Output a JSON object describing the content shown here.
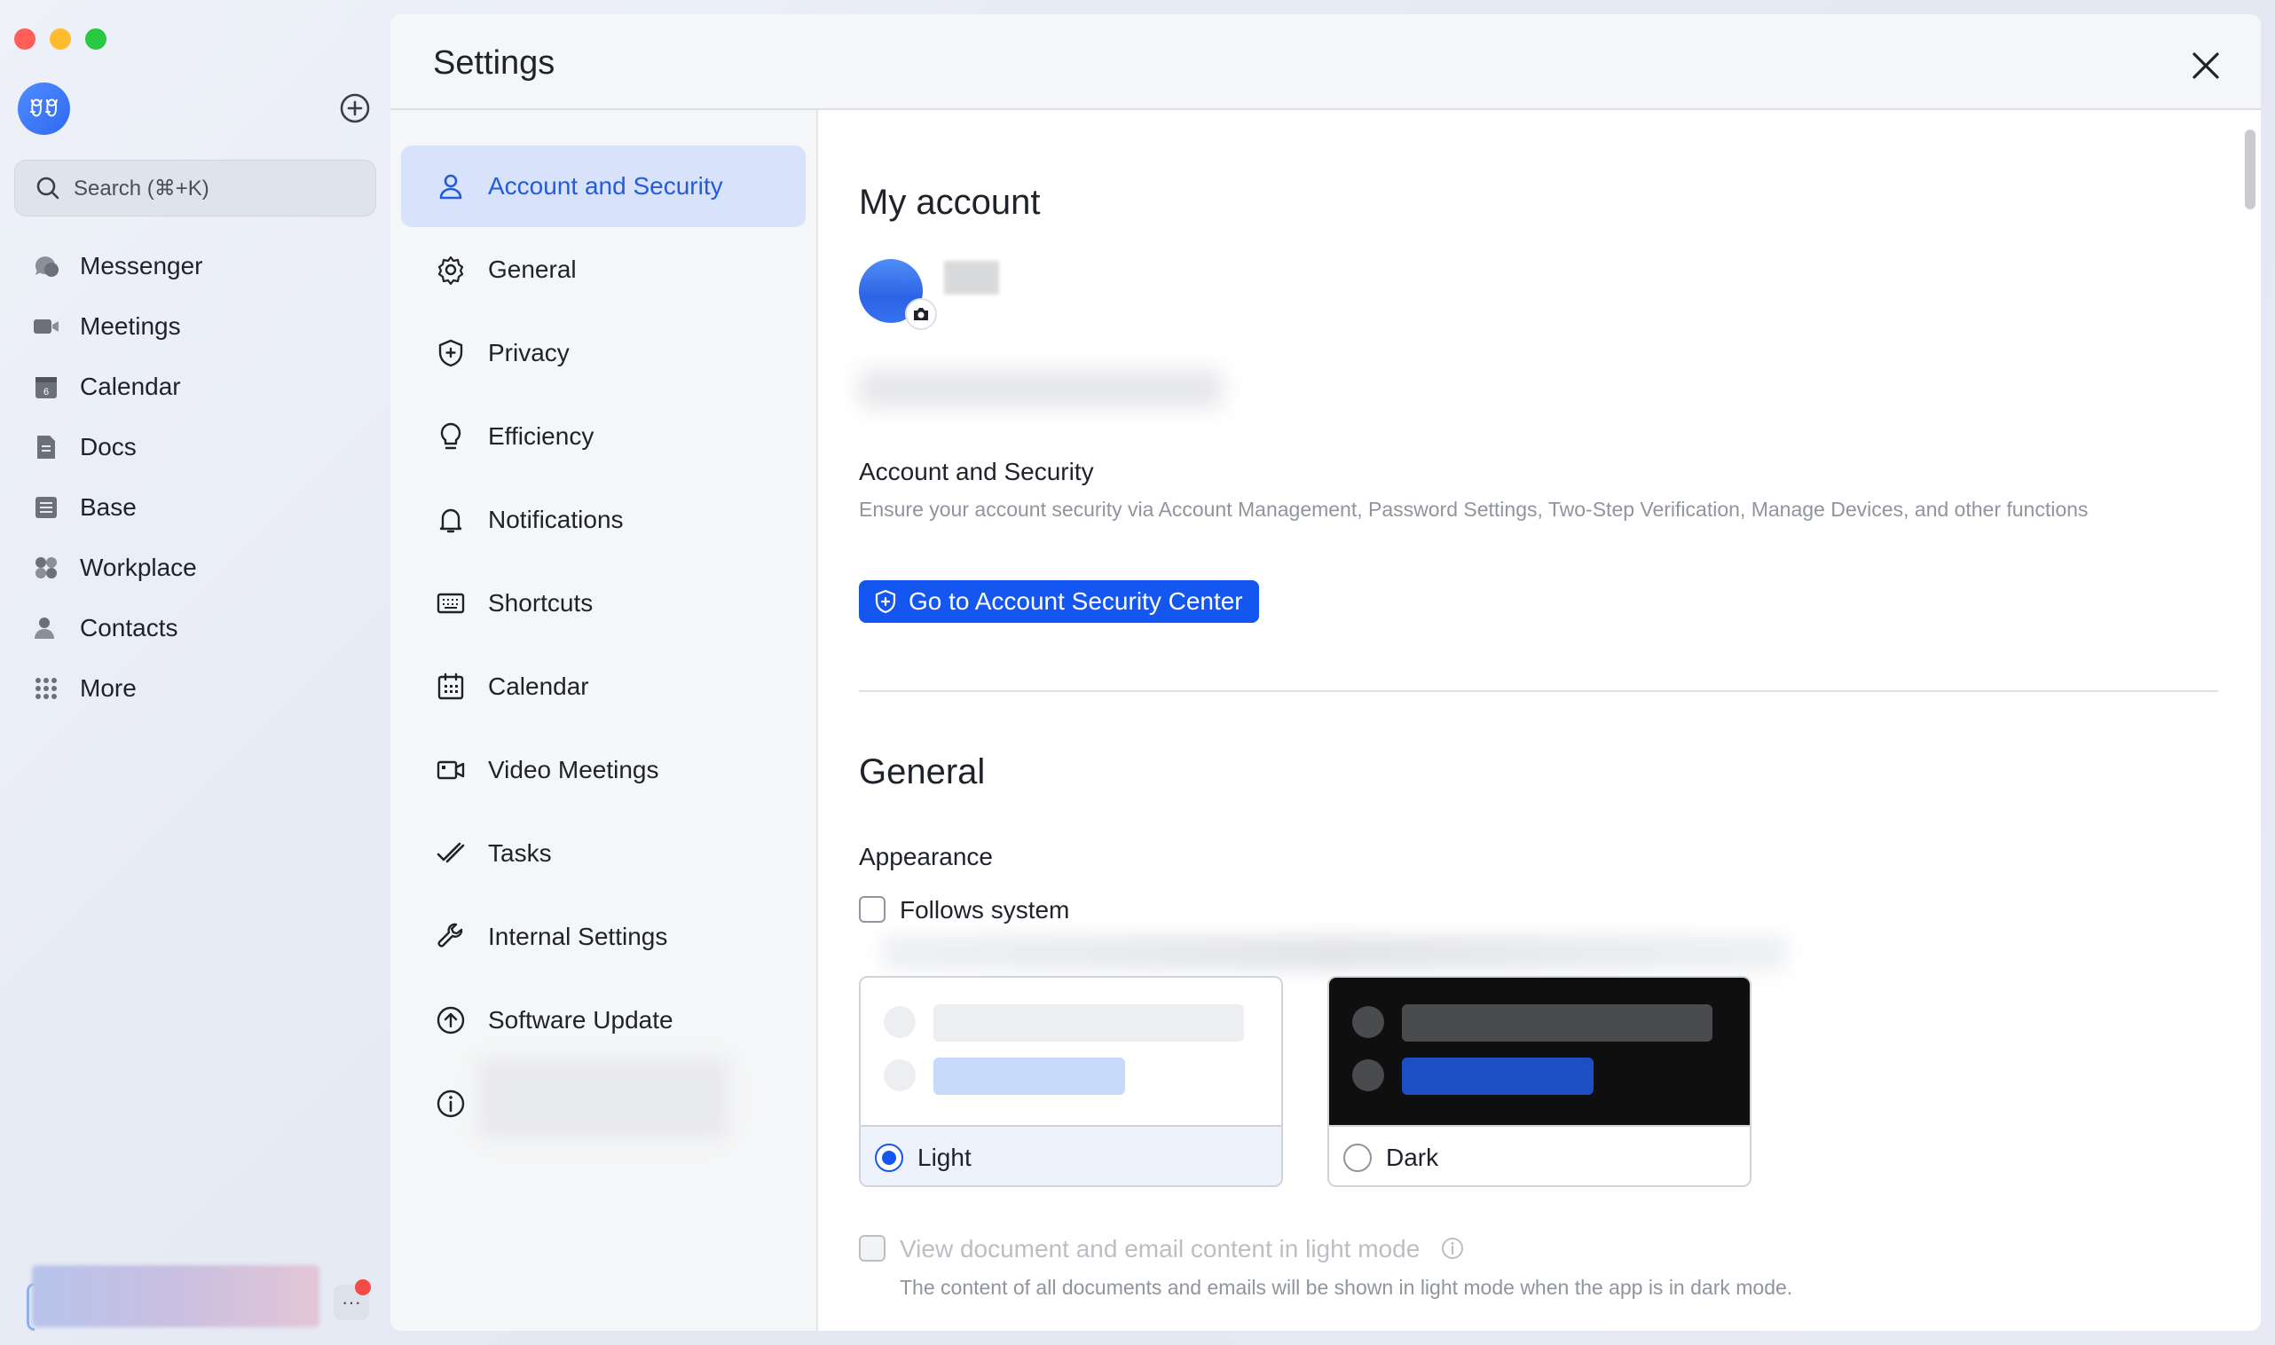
{
  "app": {
    "avatar_text": "ꀄꀄ",
    "search_placeholder": "Search (⌘+K)",
    "nav": [
      {
        "label": "Messenger",
        "icon": "chat-bubble-icon"
      },
      {
        "label": "Meetings",
        "icon": "video-camera-icon"
      },
      {
        "label": "Calendar",
        "icon": "calendar-icon"
      },
      {
        "label": "Docs",
        "icon": "docs-icon"
      },
      {
        "label": "Base",
        "icon": "base-table-icon"
      },
      {
        "label": "Workplace",
        "icon": "workplace-grid-icon"
      },
      {
        "label": "Contacts",
        "icon": "contacts-icon"
      },
      {
        "label": "More",
        "icon": "more-dots-icon"
      }
    ],
    "more_dots": "···"
  },
  "settings": {
    "title": "Settings",
    "nav": [
      {
        "label": "Account and Security",
        "icon": "user-icon",
        "active": true
      },
      {
        "label": "General",
        "icon": "gear-icon"
      },
      {
        "label": "Privacy",
        "icon": "shield-icon"
      },
      {
        "label": "Efficiency",
        "icon": "lightbulb-icon"
      },
      {
        "label": "Notifications",
        "icon": "bell-icon"
      },
      {
        "label": "Shortcuts",
        "icon": "keyboard-icon"
      },
      {
        "label": "Calendar",
        "icon": "calendar-icon"
      },
      {
        "label": "Video Meetings",
        "icon": "video-icon"
      },
      {
        "label": "Tasks",
        "icon": "tasks-check-icon"
      },
      {
        "label": "Internal Settings",
        "icon": "wrench-icon"
      },
      {
        "label": "Software Update",
        "icon": "upload-circle-icon"
      },
      {
        "label": "",
        "icon": "info-icon"
      }
    ],
    "my_account": {
      "heading": "My account",
      "security_title": "Account and Security",
      "security_desc": "Ensure your account security via Account Management, Password Settings, Two-Step Verification, Manage Devices, and other functions",
      "security_button": "Go to Account Security Center"
    },
    "general": {
      "heading": "General",
      "appearance_title": "Appearance",
      "follows_system": "Follows system",
      "themes": [
        {
          "label": "Light",
          "selected": true
        },
        {
          "label": "Dark",
          "selected": false
        }
      ],
      "light_docs_label": "View document and email content in light mode",
      "light_docs_note": "The content of all documents and emails will be shown in light mode when the app is in dark mode."
    },
    "colors": {
      "accent": "#1456f0",
      "active_nav_bg": "#d8e3fb",
      "active_nav_text": "#245bdb"
    }
  }
}
